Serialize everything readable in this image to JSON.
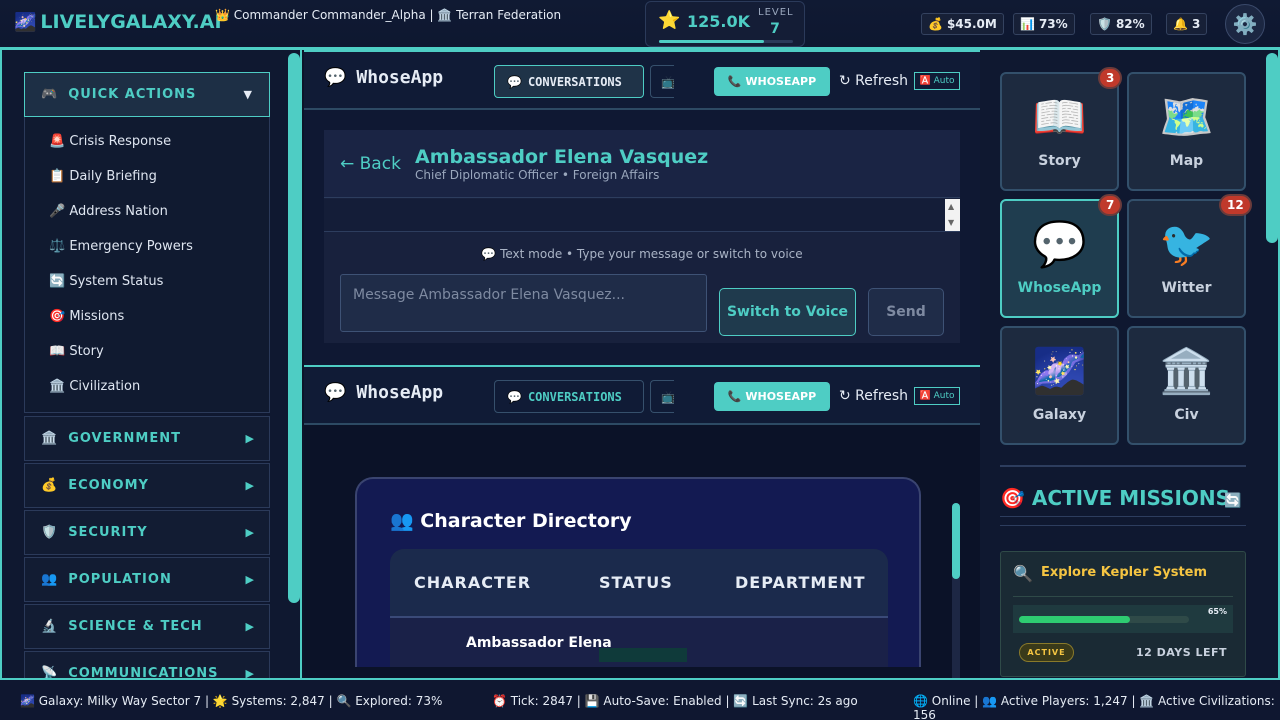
{
  "header": {
    "logo_icon": "🌌",
    "logo_text": "LIVELYGALAXY.AI",
    "commander": "👑 Commander Commander_Alpha | 🏛️ Terran Federation",
    "xp_icon": "⭐",
    "xp": "125.0K",
    "level_label": "LEVEL",
    "level": "7",
    "xp_progress": 0.78,
    "stats": [
      {
        "icon": "💰",
        "text": "$45.0M"
      },
      {
        "icon": "📊",
        "text": "73%"
      },
      {
        "icon": "🛡️",
        "text": "82%"
      },
      {
        "icon": "🔔",
        "text": "3"
      }
    ],
    "settings_icon": "⚙️"
  },
  "sidebar": {
    "quick_actions": {
      "icon": "🎮",
      "label": "QUICK ACTIONS",
      "arrow": "▼"
    },
    "quick_items": [
      "🚨 Crisis Response",
      "📋 Daily Briefing",
      "🎤 Address Nation",
      "⚖️ Emergency Powers",
      "🔄 System Status",
      "🎯 Missions",
      "📖 Story",
      "🏛️ Civilization"
    ],
    "categories": [
      {
        "icon": "🏛️",
        "label": "GOVERNMENT",
        "arrow": "▶"
      },
      {
        "icon": "💰",
        "label": "ECONOMY",
        "arrow": "▶"
      },
      {
        "icon": "🛡️",
        "label": "SECURITY",
        "arrow": "▶"
      },
      {
        "icon": "👥",
        "label": "POPULATION",
        "arrow": "▶"
      },
      {
        "icon": "🔬",
        "label": "SCIENCE & TECH",
        "arrow": "▶"
      },
      {
        "icon": "📡",
        "label": "COMMUNICATIONS",
        "arrow": "▶"
      }
    ]
  },
  "chat_pane": {
    "title_icon": "💬",
    "title": "WhoseApp",
    "tab_icon": "💬",
    "tab_label": "CONVERSATIONS",
    "tab2_icon": "📺",
    "whoseapp_button": "📞 WHOSEAPP",
    "refresh": "↻ Refresh",
    "auto": "🅰️ Auto",
    "back": "← Back",
    "contact_name": "Ambassador Elena Vasquez",
    "contact_role": "Chief Diplomatic Officer • Foreign Affairs",
    "hint": "💬 Text mode • Type your message or switch to voice",
    "input_placeholder": "Message Ambassador Elena Vasquez...",
    "voice_button": "Switch to Voice",
    "send_button": "Send"
  },
  "directory_pane": {
    "title_icon": "💬",
    "title": "WhoseApp",
    "tab_icon": "💬",
    "tab_label": "CONVERSATIONS",
    "tab2_icon": "📺",
    "whoseapp_button": "📞 WHOSEAPP",
    "refresh": "↻ Refresh",
    "auto": "🅰️ Auto",
    "directory_title": "👥 Character Directory",
    "columns": [
      "CHARACTER",
      "STATUS",
      "DEPARTMENT"
    ],
    "rows": [
      {
        "name": "Ambassador Elena"
      }
    ]
  },
  "apps": [
    {
      "icon": "📖",
      "label": "Story",
      "badge": "3"
    },
    {
      "icon": "🗺️",
      "label": "Map",
      "badge": ""
    },
    {
      "icon": "💬",
      "label": "WhoseApp",
      "badge": "7"
    },
    {
      "icon": "🐦",
      "label": "Witter",
      "badge": "12"
    },
    {
      "icon": "🌌",
      "label": "Galaxy",
      "badge": ""
    },
    {
      "icon": "🏛️",
      "label": "Civ",
      "badge": ""
    }
  ],
  "missions": {
    "title": "🎯 ACTIVE MISSIONS",
    "refresh_icon": "🔄",
    "items": [
      {
        "icon": "🔍",
        "name": "Explore Kepler System",
        "progress_label": "65%",
        "progress": 0.65,
        "status": "ACTIVE",
        "days_left": "12 DAYS LEFT"
      }
    ]
  },
  "footer": {
    "left": "🌌 Galaxy: Milky Way Sector 7 | 🌟 Systems: 2,847 | 🔍 Explored: 73%",
    "center": "⏰ Tick: 2847 | 💾 Auto-Save: Enabled | 🔄 Last Sync: 2s ago",
    "right": "🌐 Online | 👥 Active Players: 1,247 | 🏛️ Active Civilizations: 156"
  },
  "colors": {
    "accent": "#4ecdc4",
    "gold": "#f5c542",
    "badge": "#c0392b",
    "progress": "#2ecc71"
  }
}
